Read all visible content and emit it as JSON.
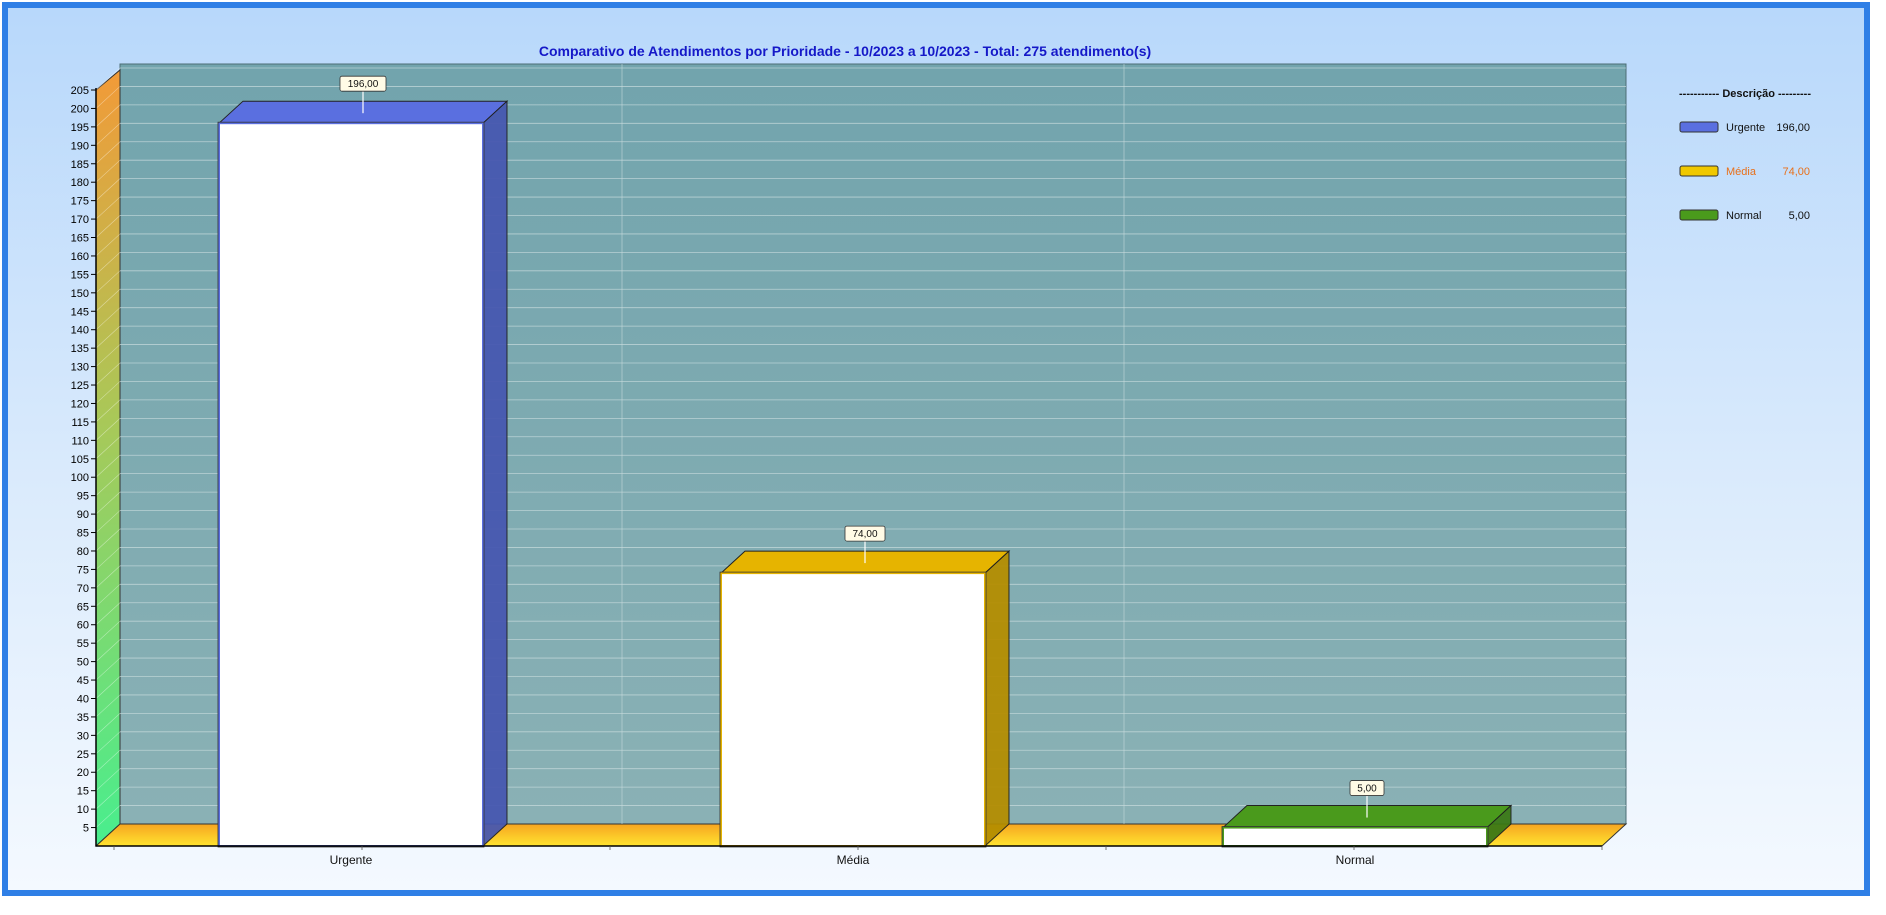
{
  "chart_data": {
    "type": "bar",
    "title": "Comparativo de Atendimentos por Prioridade - 10/2023 a 10/2023 - Total: 275 atendimento(s)",
    "categories": [
      "Urgente",
      "Média",
      "Normal"
    ],
    "values": [
      196,
      74,
      5
    ],
    "value_labels": [
      "196,00",
      "74,00",
      "5,00"
    ],
    "colors": [
      "#5a6fe0",
      "#e6b400",
      "#4a9a1c"
    ],
    "ylim": [
      0,
      205
    ],
    "ytick_step": 5,
    "grid": true,
    "legend": {
      "title": "----------- Descrição ---------",
      "position": "right",
      "entries": [
        {
          "name": "Urgente",
          "value": "196,00",
          "color": "#5a6fe0",
          "text_color": "#111111"
        },
        {
          "name": "Média",
          "value": "74,00",
          "color": "#f0c800",
          "text_color": "#e8701a"
        },
        {
          "name": "Normal",
          "value": "5,00",
          "color": "#4a9a1c",
          "text_color": "#111111"
        }
      ]
    }
  }
}
